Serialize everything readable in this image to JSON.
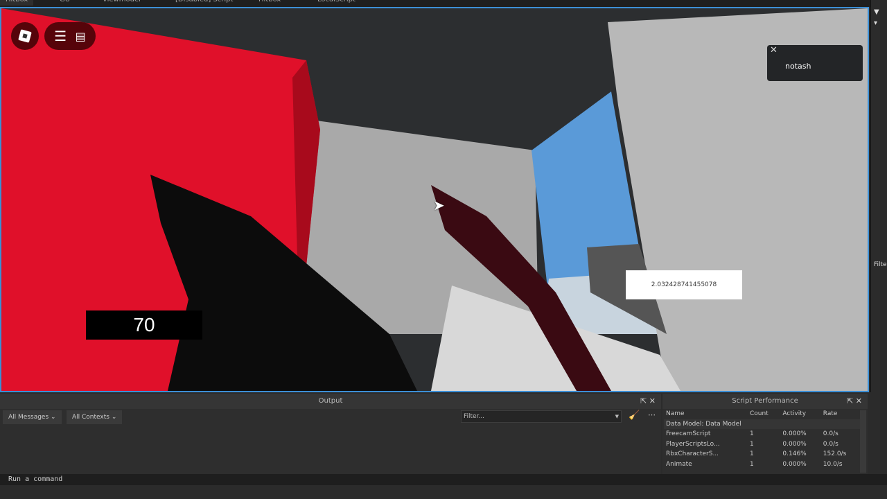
{
  "tabs": [
    {
      "label": "Hitbox"
    },
    {
      "label": "GU"
    },
    {
      "label": "Viewmodel"
    },
    {
      "label": "[Disabled] Script"
    },
    {
      "label": "Hitbox"
    },
    {
      "label": "LocalScript"
    }
  ],
  "game": {
    "notification": {
      "text": "notash"
    },
    "ammo": "70",
    "value_display": "2.032428741455078"
  },
  "right_panel": {
    "filter_label": "Filte"
  },
  "output": {
    "title": "Output",
    "messages_dropdown": "All Messages",
    "contexts_dropdown": "All Contexts",
    "filter_placeholder": "Filter..."
  },
  "script_performance": {
    "title": "Script Performance",
    "columns": [
      "Name",
      "Count",
      "Activity",
      "Rate"
    ],
    "group": "Data Model: Data Model",
    "rows": [
      {
        "name": "FreecamScript",
        "count": "1",
        "activity": "0.000%",
        "rate": "0.0/s"
      },
      {
        "name": "PlayerScriptsLo...",
        "count": "1",
        "activity": "0.000%",
        "rate": "0.0/s"
      },
      {
        "name": "RbxCharacterS...",
        "count": "1",
        "activity": "0.146%",
        "rate": "152.0/s"
      },
      {
        "name": "Animate",
        "count": "1",
        "activity": "0.000%",
        "rate": "10.0/s"
      }
    ]
  },
  "command_bar": {
    "placeholder": "Run a command"
  }
}
